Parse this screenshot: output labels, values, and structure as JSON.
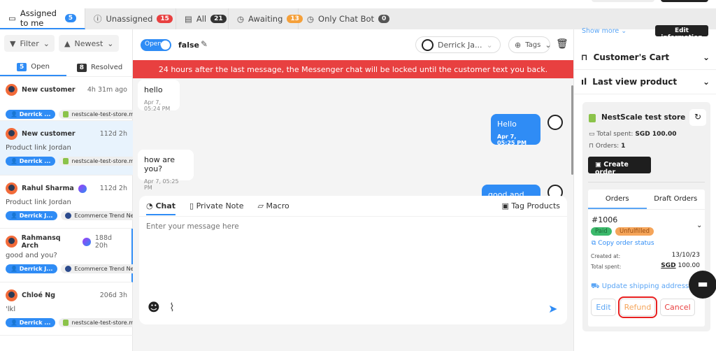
{
  "tabs": [
    {
      "label": "Assigned to me",
      "count": "5",
      "color": "#2f8cf5",
      "icon": "chat-icon"
    },
    {
      "label": "Unassigned",
      "count": "15",
      "color": "#e84040",
      "icon": "alert-icon"
    },
    {
      "label": "All",
      "count": "21",
      "color": "#333333",
      "icon": "list-icon"
    },
    {
      "label": "Awaiting",
      "count": "13",
      "color": "#f5a03a",
      "icon": "clock-icon"
    },
    {
      "label": "Only Chat Bot",
      "count": "0",
      "color": "#555555",
      "icon": "clock-icon"
    }
  ],
  "filters": {
    "filter": "Filter",
    "sort": "Newest"
  },
  "subtabs": {
    "open_count": "5",
    "open": "Open",
    "resolved_count": "8",
    "resolved": "Resolved"
  },
  "conversations": [
    {
      "name": "New customer",
      "time": "4h 31m ago",
      "preview": "",
      "agent": "Derrick ...",
      "channel": "nestscale-test-store.my...",
      "channel_type": "shopify",
      "messenger": false
    },
    {
      "name": "New customer",
      "time": "112d 2h",
      "preview": "Product link Jordan",
      "agent": "Derrick ...",
      "channel": "nestscale-test-store.my...",
      "channel_type": "shopify",
      "messenger": false
    },
    {
      "name": "Rahul Sharma",
      "time": "112d 2h",
      "preview": "Product link Jordan",
      "agent": "Derrick J...",
      "channel": "Ecommerce Trend Nes...",
      "channel_type": "facebook",
      "messenger": true
    },
    {
      "name": "Rahmansq Arch",
      "time": "188d 20h",
      "preview": "good and you?",
      "agent": "Derrick J...",
      "channel": "Ecommerce Trend Ne...",
      "channel_type": "facebook",
      "messenger": true
    },
    {
      "name": "Chloé Ng",
      "time": "206d 3h",
      "preview": "'lkl",
      "agent": "Derrick ...",
      "channel": "nestscale-test-store.my...",
      "channel_type": "shopify",
      "messenger": false
    }
  ],
  "header": {
    "status": "Open",
    "title": "false",
    "assignee": "Derrick Ja...",
    "tags": "Tags"
  },
  "banner": "24 hours after the last message, the Messenger chat will be locked until the customer text you back.",
  "messages": [
    {
      "text": "hello",
      "time": "Apr 7, 05:24 PM",
      "dir": "in"
    },
    {
      "text": "Hello",
      "time": "Apr 7, 05:25 PM",
      "dir": "out"
    },
    {
      "text": "how are you?",
      "time": "Apr 7, 05:25 PM",
      "dir": "in"
    },
    {
      "text": "good and you?",
      "time": "",
      "dir": "out"
    }
  ],
  "composer": {
    "tabs": [
      "Chat",
      "Private Note",
      "Macro"
    ],
    "tag_products": "Tag Products",
    "placeholder": "Enter your message here"
  },
  "right": {
    "show_more": "Show more",
    "edit_info": "Edit information",
    "cart": "Customer's Cart",
    "last_view": "Last view product",
    "store": "NestScale test store",
    "total_spent_label": "Total spent:",
    "total_spent": "SGD 100.00",
    "orders_label": "Orders:",
    "orders": "1",
    "create_order": "Create order",
    "order_tabs": [
      "Orders",
      "Draft Orders"
    ],
    "order_id": "#1006",
    "paid": "Paid",
    "unfulfilled": "Unfulfilled",
    "copy_status": "Copy order status",
    "created_label": "Created at:",
    "created": "13/10/23",
    "spent_label": "Total spent:",
    "spent_cur": "SGD",
    "spent_val": "100.00",
    "update_shipping": "Update shipping address",
    "edit": "Edit",
    "refund": "Refund",
    "cancel": "Cancel"
  }
}
